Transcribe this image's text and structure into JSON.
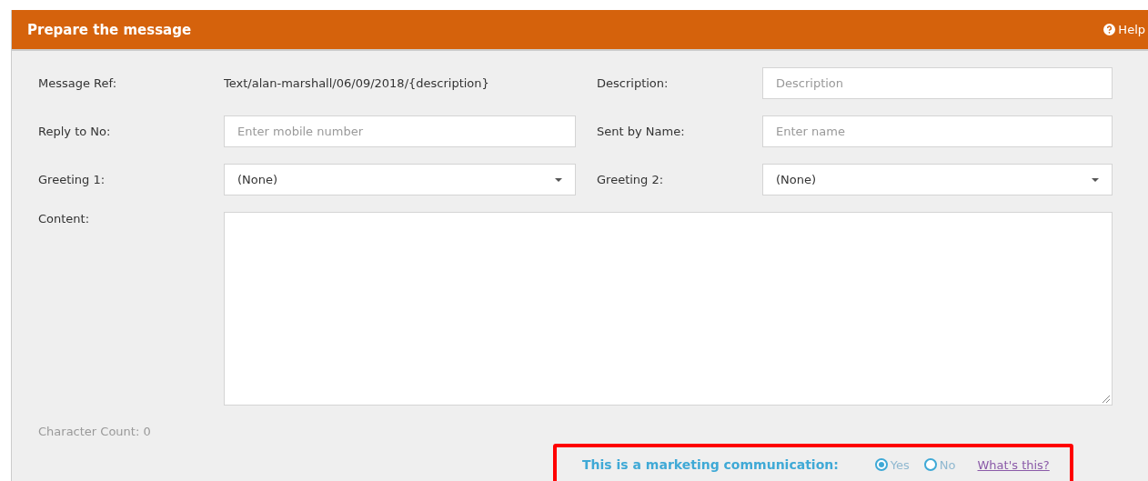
{
  "panel": {
    "title": "Prepare the message",
    "help": "Help"
  },
  "fields": [
    {
      "kind": "static",
      "label": "Message Ref:",
      "value": "Text/alan-marshall/06/09/2018/{description}"
    },
    {
      "kind": "input",
      "label": "Description:",
      "placeholder": "Description"
    },
    {
      "kind": "input",
      "label": "Reply to No:",
      "placeholder": "Enter mobile number"
    },
    {
      "kind": "input",
      "label": "Sent by Name:",
      "placeholder": "Enter name"
    },
    {
      "kind": "select",
      "label": "Greeting 1:",
      "value": "(None)"
    },
    {
      "kind": "select",
      "label": "Greeting 2:",
      "value": "(None)"
    }
  ],
  "content": {
    "label": "Content:"
  },
  "character_count": "Character Count: 0",
  "marketing": {
    "label": "This is a marketing communication:",
    "options": [
      {
        "label": "Yes",
        "selected": true
      },
      {
        "label": "No",
        "selected": false
      }
    ],
    "link": "What's this?"
  }
}
